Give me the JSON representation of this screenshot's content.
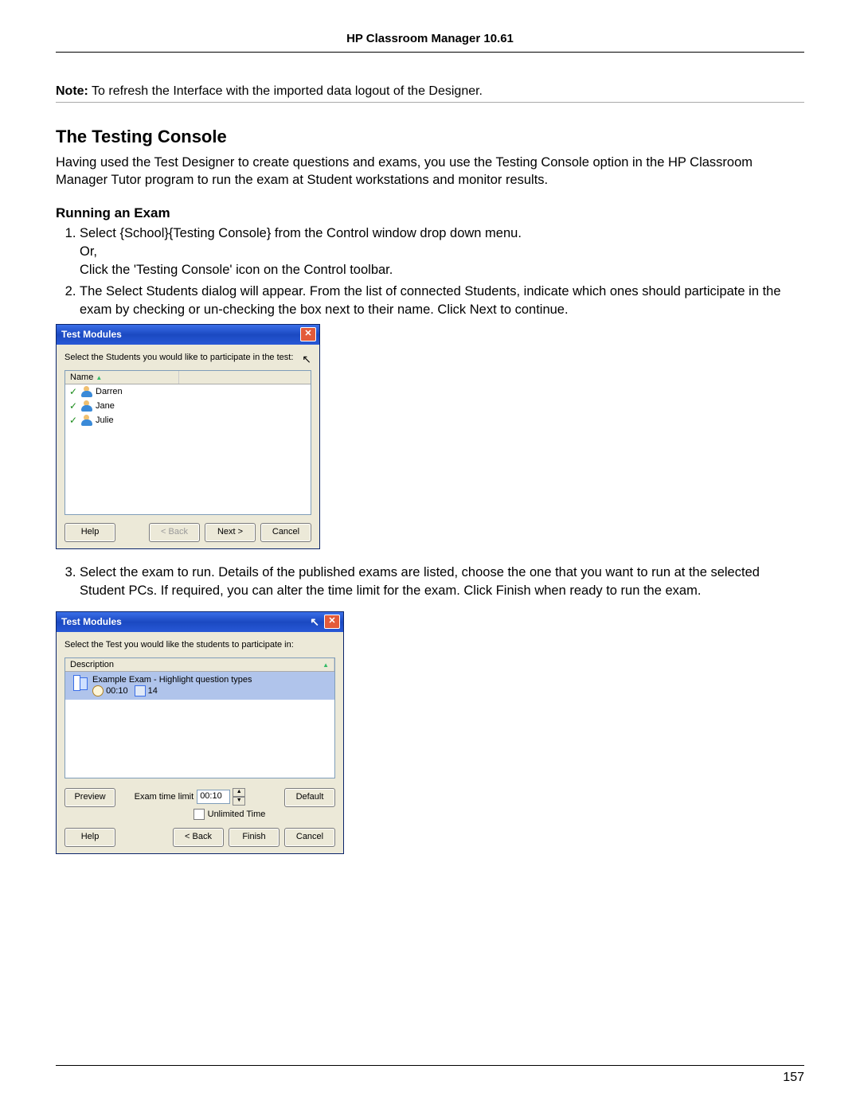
{
  "header": {
    "title": "HP Classroom Manager 10.61"
  },
  "note": {
    "label": "Note:",
    "text": "To refresh the Interface with the imported data logout of the Designer."
  },
  "section": {
    "title": "The Testing Console",
    "intro": "Having used the Test Designer to create questions and exams, you use the Testing Console option in the HP Classroom Manager Tutor program to run the exam at Student workstations and monitor results."
  },
  "subsection": {
    "title": "Running an Exam"
  },
  "steps": {
    "s1": "Select {School}{Testing Console} from the Control window drop down menu.",
    "s1_or": "Or,",
    "s1_alt": "Click the 'Testing Console' icon on the Control toolbar.",
    "s2": "The Select Students dialog will appear. From the list of connected Students, indicate which ones should participate in the exam by checking or un-checking the box next to their name. Click Next to continue.",
    "s3": "Select the exam to run. Details of the published exams are listed, choose the one that you want to run at the selected Student PCs. If required, you can alter the time limit for the exam. Click Finish when ready to run the exam."
  },
  "dialog1": {
    "title": "Test Modules",
    "instruction": "Select the Students you would like to participate in the test:",
    "header_name": "Name",
    "students": [
      "Darren",
      "Jane",
      "Julie"
    ],
    "buttons": {
      "help": "Help",
      "back": "< Back",
      "next": "Next >",
      "cancel": "Cancel"
    }
  },
  "dialog2": {
    "title": "Test Modules",
    "instruction": "Select the Test you would like the students to participate in:",
    "header_desc": "Description",
    "exam": {
      "title": "Example Exam - Highlight question types",
      "time": "00:10",
      "question_count": "14"
    },
    "time_limit_label": "Exam time limit",
    "time_limit_value": "00:10",
    "unlimited_label": "Unlimited Time",
    "buttons": {
      "preview": "Preview",
      "default": "Default",
      "help": "Help",
      "back": "< Back",
      "finish": "Finish",
      "cancel": "Cancel"
    }
  },
  "page_number": "157"
}
